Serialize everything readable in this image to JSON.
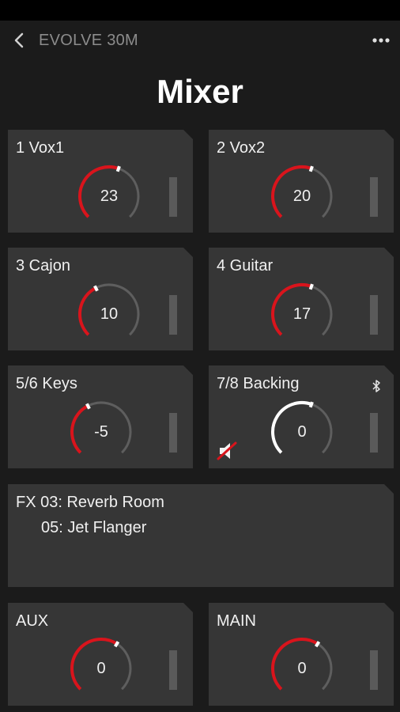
{
  "header": {
    "device_name": "EVOLVE 30M",
    "title": "Mixer"
  },
  "colors": {
    "accent_red": "#d9141c",
    "knob_track": "#5e5e5e",
    "knob_active_white": "#ffffff",
    "card_bg": "#363636",
    "page_bg": "#1b1b1b"
  },
  "channels": [
    {
      "label": "1 Vox1",
      "value": "23",
      "level": 0.57
    },
    {
      "label": "2 Vox2",
      "value": "20",
      "level": 0.57
    },
    {
      "label": "3 Cajon",
      "value": "10",
      "level": 0.4
    },
    {
      "label": "4 Guitar",
      "value": "17",
      "level": 0.57
    },
    {
      "label": "5/6 Keys",
      "value": "-5",
      "level": 0.4
    },
    {
      "label": "7/8 Backing",
      "value": "0",
      "level": 0.57,
      "muted": true,
      "bluetooth": true
    }
  ],
  "fx": {
    "prefix": "FX",
    "line1": "03: Reverb Room",
    "line2": "05: Jet Flanger"
  },
  "outputs": [
    {
      "label": "AUX",
      "value": "0",
      "level": 0.62
    },
    {
      "label": "MAIN",
      "value": "0",
      "level": 0.62
    }
  ],
  "icons": [
    "back-chevron-icon",
    "more-dots-icon",
    "bluetooth-icon",
    "speaker-muted-icon"
  ]
}
